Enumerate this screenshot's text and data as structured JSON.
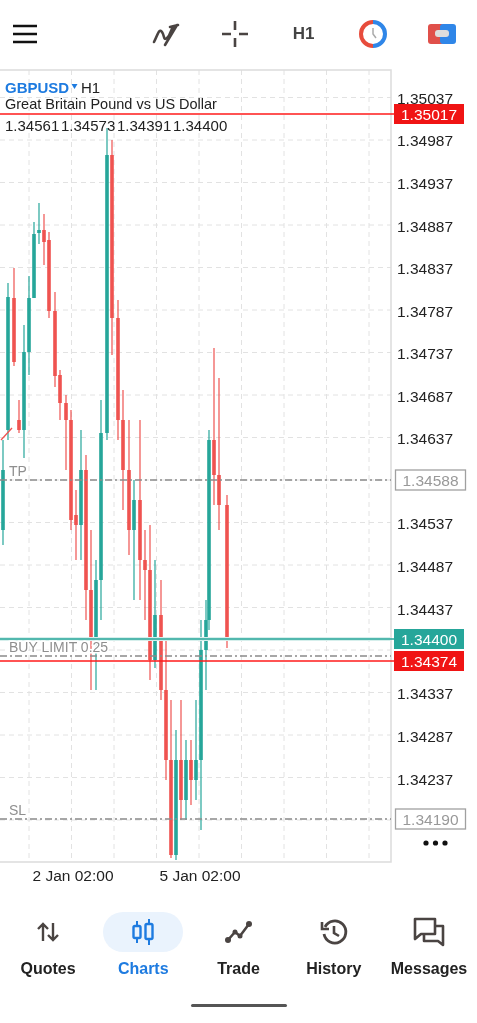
{
  "header": {
    "timeframe": "H1"
  },
  "chart": {
    "symbol": "GBPUSD",
    "timeframe": "H1",
    "description": "Great Britain Pound vs US Dollar",
    "ohlc": [
      "1.34561",
      "1.34573",
      "1.34391",
      "1.34400"
    ],
    "price_ticks": [
      "1.35037",
      "1.34987",
      "1.34937",
      "1.34887",
      "1.34837",
      "1.34787",
      "1.34737",
      "1.34687",
      "1.34637",
      "1.34537",
      "1.34487",
      "1.34437",
      "1.34337",
      "1.34287",
      "1.34237"
    ],
    "price_lines": [
      {
        "kind": "ask",
        "price": "1.35017"
      },
      {
        "kind": "bid",
        "price": "1.34400"
      },
      {
        "kind": "ask",
        "price": "1.34374"
      }
    ],
    "orders": [
      {
        "label": "TP",
        "price": "1.34588"
      },
      {
        "label": "BUY LIMIT 0.25"
      },
      {
        "label": "SL",
        "price": "1.34190"
      }
    ],
    "time_labels": [
      "2 Jan 02:00",
      "5 Jan 02:00"
    ]
  },
  "nav": [
    {
      "kind": "quotes",
      "label": "Quotes",
      "selected": false
    },
    {
      "kind": "charts",
      "label": "Charts",
      "selected": true
    },
    {
      "kind": "trade",
      "label": "Trade",
      "selected": false
    },
    {
      "kind": "history",
      "label": "History",
      "selected": false
    },
    {
      "kind": "messages",
      "label": "Messages",
      "selected": false
    }
  ]
}
